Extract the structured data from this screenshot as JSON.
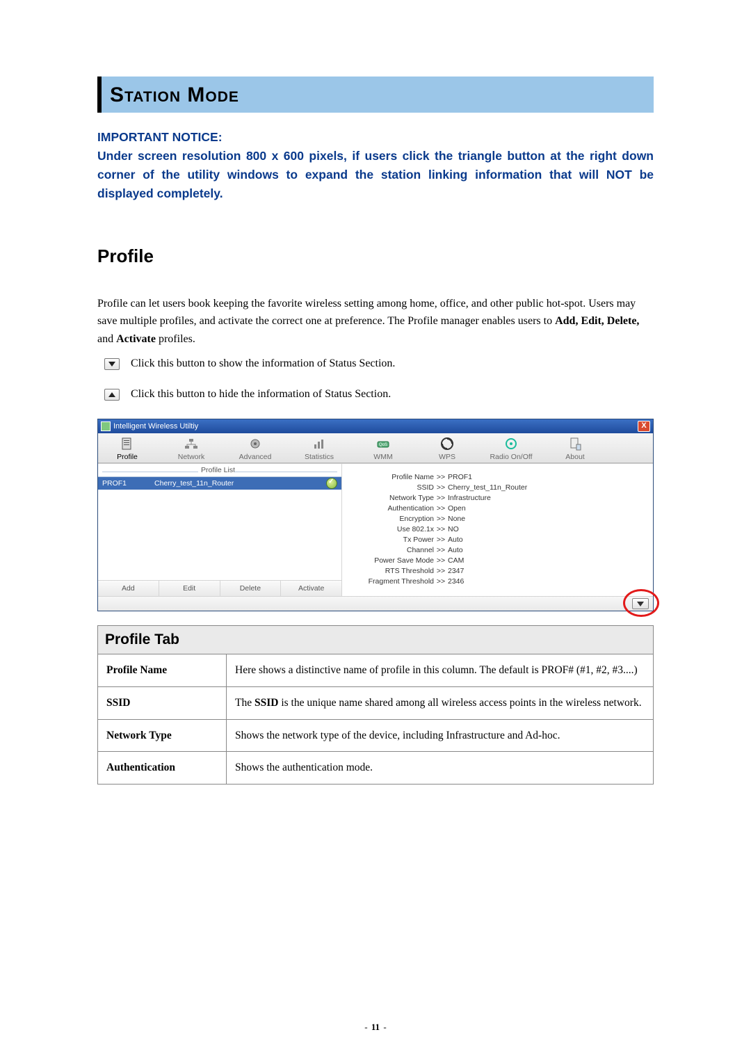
{
  "banner": {
    "title": "Station Mode"
  },
  "notice": {
    "heading": "IMPORTANT NOTICE:",
    "body": "Under screen resolution 800 x 600 pixels, if users click the triangle button at the right down corner of the utility windows to expand the station linking information that will NOT be displayed completely."
  },
  "h2": "Profile",
  "intro": {
    "p1_a": "Profile can let users book keeping the favorite wireless setting among home, office, and other public hot-spot. Users may save multiple profiles, and activate the correct one at preference. The Profile manager enables users to ",
    "p1_b_bold": "Add, Edit, Delete,",
    "p1_c": " and ",
    "p1_d_bold": "Activate",
    "p1_e": " profiles."
  },
  "bullets": {
    "show": "Click this button to show the information of Status Section.",
    "hide": "Click this button to hide the information of Status Section."
  },
  "app": {
    "title": "Intelligent Wireless Utiltiy",
    "tabs": {
      "profile": "Profile",
      "network": "Network",
      "advanced": "Advanced",
      "statistics": "Statistics",
      "wmm": "WMM",
      "wps": "WPS",
      "radio": "Radio On/Off",
      "about": "About"
    },
    "profile_list_label": "Profile List",
    "row": {
      "name": "PROF1",
      "ssid": "Cherry_test_11n_Router"
    },
    "buttons": {
      "add": "Add",
      "edit": "Edit",
      "delete": "Delete",
      "activate": "Activate"
    },
    "detailArrow": ">>",
    "details": {
      "profile_name": {
        "k": "Profile Name",
        "v": "PROF1"
      },
      "ssid": {
        "k": "SSID",
        "v": "Cherry_test_11n_Router"
      },
      "network_type": {
        "k": "Network Type",
        "v": "Infrastructure"
      },
      "auth": {
        "k": "Authentication",
        "v": "Open"
      },
      "enc": {
        "k": "Encryption",
        "v": "None"
      },
      "use8021x": {
        "k": "Use 802.1x",
        "v": "NO"
      },
      "txpower": {
        "k": "Tx Power",
        "v": "Auto"
      },
      "channel": {
        "k": "Channel",
        "v": "Auto"
      },
      "psm": {
        "k": "Power Save Mode",
        "v": "CAM"
      },
      "rts": {
        "k": "RTS Threshold",
        "v": "2347"
      },
      "frag": {
        "k": "Fragment Threshold",
        "v": "2346"
      }
    }
  },
  "profile_tab": {
    "header": "Profile Tab",
    "rows": {
      "profile_name": {
        "k": "Profile Name",
        "v": "Here shows a distinctive name of profile in this column. The default is PROF# (#1, #2, #3....)"
      },
      "ssid": {
        "k": "SSID",
        "v_a": "The ",
        "v_bold": "SSID",
        "v_b": " is the unique name shared among all wireless access points in the wireless network."
      },
      "network_type": {
        "k": "Network Type",
        "v": "Shows the network type of the device, including Infrastructure and Ad-hoc."
      },
      "authentication": {
        "k": "Authentication",
        "v": "Shows the authentication mode."
      }
    }
  },
  "page_number": "11"
}
